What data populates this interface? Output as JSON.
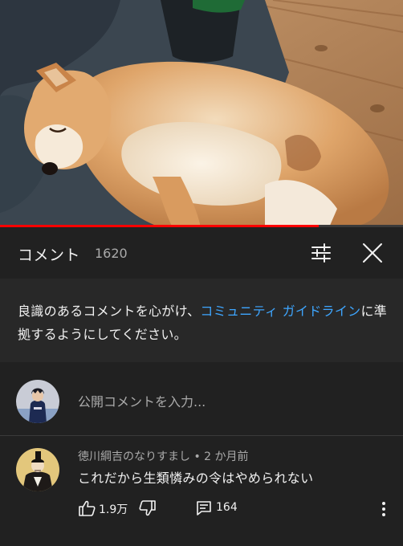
{
  "video": {
    "progress_fraction": 0.79
  },
  "comments": {
    "title": "コメント",
    "count": "1620",
    "filter_icon": "sliders-icon",
    "close_icon": "close-icon"
  },
  "notice": {
    "text_before": "良識のあるコメントを心がけ、",
    "link": "コミュニティ ガイドライン",
    "text_after": "に準拠するようにしてください。"
  },
  "add_comment": {
    "placeholder": "公開コメントを入力..."
  },
  "comment": {
    "author": "徳川綱吉のなりすまし",
    "time": "2 か月前",
    "separator": " • ",
    "text": "これだから生類憐みの令はやめられない",
    "likes": "1.9万",
    "replies": "164"
  },
  "colors": {
    "background": "#212121",
    "notice_background": "#282828",
    "link": "#3ea6ff",
    "progress": "#ff0000"
  }
}
